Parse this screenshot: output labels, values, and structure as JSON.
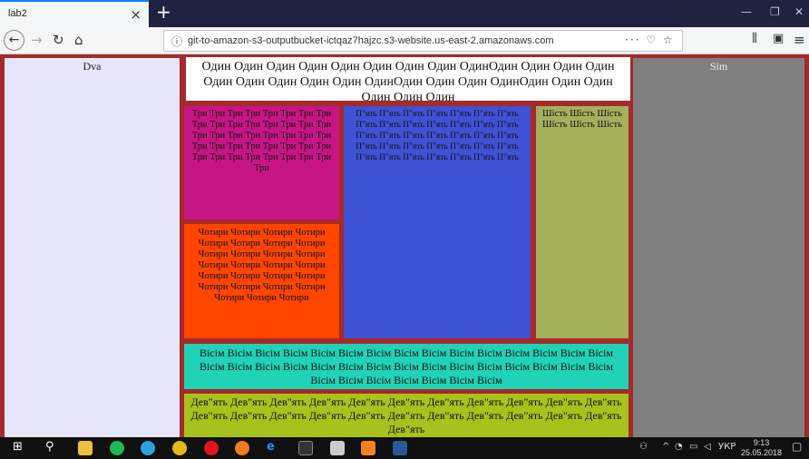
{
  "browser": {
    "tab_title": "lab2",
    "tab_close": "×",
    "new_tab": "+",
    "url": "git-to-amazon-s3-outputbucket-ictqaz7hajzc.s3-website.us-east-2.amazonaws.com",
    "url_actions": "··· ♡ ☆"
  },
  "page": {
    "dva": "Dva",
    "sim": "Sim",
    "odin": "Один Один Один Один Один Один Один Один ОдинОдин Один Один Один Один Один Один Один Один ОдинОдин Один Один ОдинОдин Один Один Один Один Один",
    "tri": "Три Три Три Три Три Три Три Три Три Три Три Три Три Три Три Три Три Три Три Три Три Три Три Три Три Три Три Три Три Три Три Три Три Три Три Три Три Три Три Три Три",
    "chotyry": "Чотири Чотири Чотири Чотири Чотири Чотири Чотири Чотири Чотири Чотири Чотири Чотири Чотири Чотири Чотири Чотири Чотири Чотири Чотири Чотири Чотири Чотири Чотири Чотири Чотири Чотири Чотири",
    "piat": "П\"ять П\"ять П\"ять П\"ять П\"ять П\"ять П\"ять П\"ять П\"ять П\"ять П\"ять П\"ять П\"ять П\"ять П\"ять П\"ять П\"ять П\"ять П\"ять П\"ять П\"ять П\"ять П\"ять П\"ять П\"ять П\"ять П\"ять П\"ять П\"ять П\"ять П\"ять П\"ять П\"ять П\"ять П\"ять",
    "shist": "Шість Шість Шість Шість Шість Шість",
    "visim": "Вісім Вісім Вісім Вісім Вісім Вісім Вісім Вісім Вісім Вісім Вісім Вісім Вісім Вісім Вісім Вісім Вісім Вісім Вісім Вісім Вісім Вісім Вісім Вісім Вісім Вісім Вісім Вісім Вісім Вісім Вісім Вісім Вісім Вісім Вісім Вісім Вісім",
    "deviat": "Дев\"ять Дев\"ять Дев\"ять Дев\"ять Дев\"ять Дев\"ять Дев\"ять Дев\"ять Дев\"ять Дев\"ять Дев\"ять Дев\"ять Дев\"ять Дев\"ять Дев\"ять Дев\"ять Дев\"ять Дев\"ять Дев\"ять Дев\"ять Дев\"ять Дев\"ять Дев\"ять"
  },
  "taskbar": {
    "lang": "УКР",
    "time": "9:13",
    "date": "25.05.2018"
  },
  "colors": {
    "page_border": "#a52a2a",
    "dva_bg": "#e6e6fa",
    "sim_bg": "#808080",
    "tri_bg": "#c71585",
    "chotyry_bg": "#ff4500",
    "piat_bg": "#3f51d4",
    "shist_bg": "#a4b05a",
    "visim_bg": "#20d2b6",
    "deviat_bg": "#a7c21c"
  }
}
